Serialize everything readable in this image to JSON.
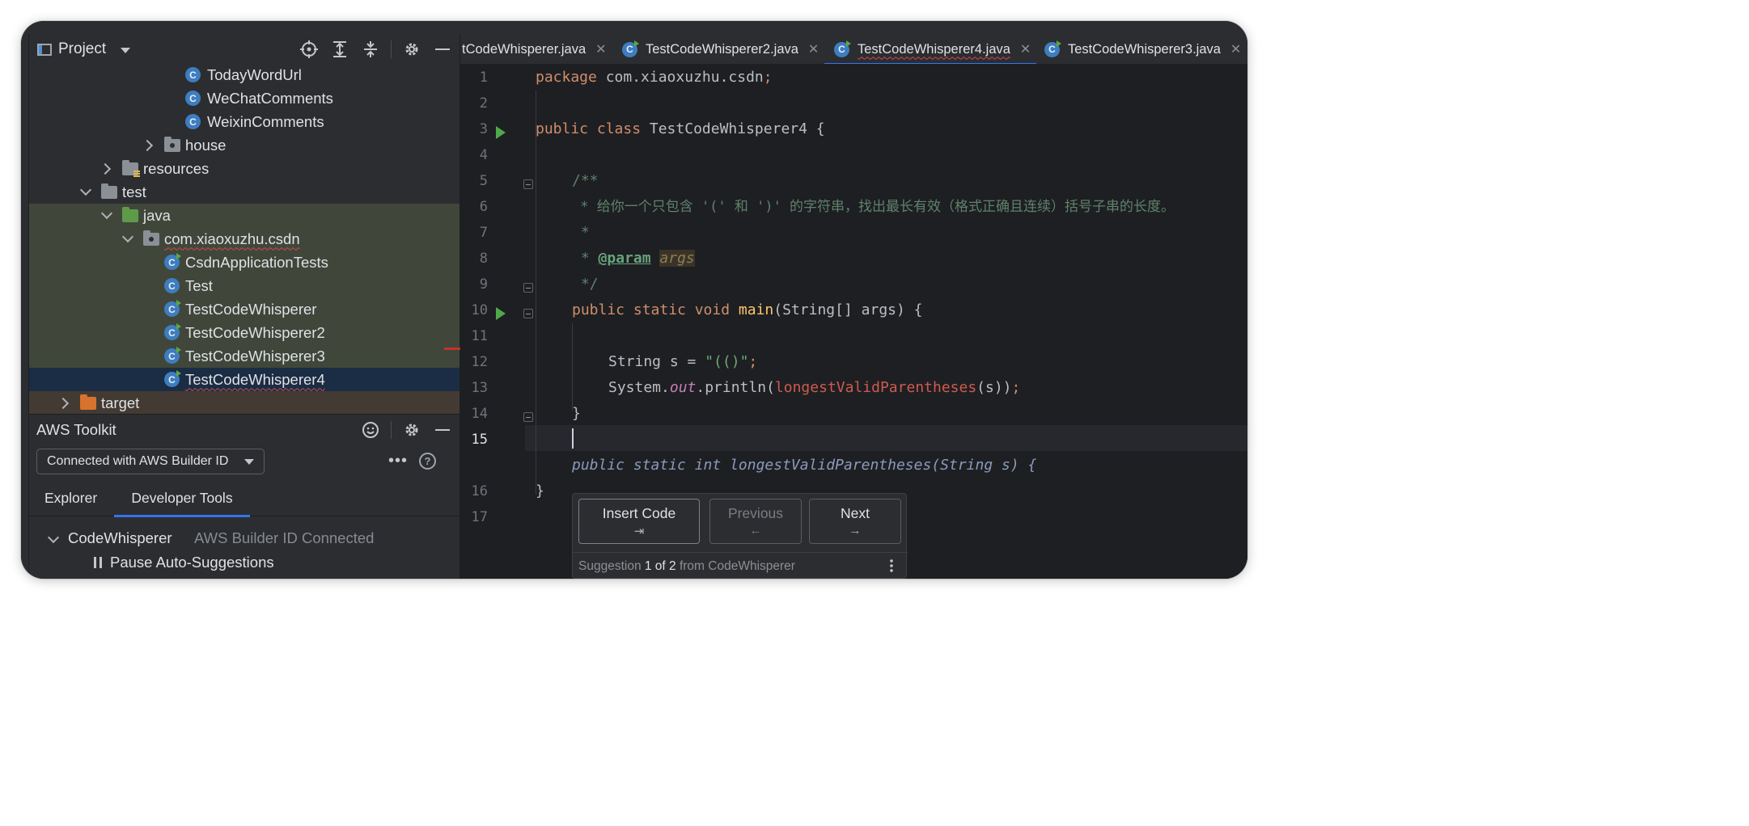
{
  "project_panel": {
    "title": "Project",
    "tree": [
      {
        "label": "TodayWordUrl",
        "kind": "class"
      },
      {
        "label": "WeChatComments",
        "kind": "class"
      },
      {
        "label": "WeixinComments",
        "kind": "class"
      },
      {
        "label": "house",
        "kind": "package-folder",
        "expanded": false
      },
      {
        "label": "resources",
        "kind": "resources-folder",
        "expanded": false
      },
      {
        "label": "test",
        "kind": "folder",
        "expanded": true
      },
      {
        "label": "java",
        "kind": "test-source-folder",
        "expanded": true
      },
      {
        "label": "com.xiaoxuzhu.csdn",
        "kind": "package",
        "expanded": true
      },
      {
        "label": "CsdnApplicationTests",
        "kind": "class"
      },
      {
        "label": "Test",
        "kind": "class"
      },
      {
        "label": "TestCodeWhisperer",
        "kind": "class"
      },
      {
        "label": "TestCodeWhisperer2",
        "kind": "class"
      },
      {
        "label": "TestCodeWhisperer3",
        "kind": "class"
      },
      {
        "label": "TestCodeWhisperer4",
        "kind": "class",
        "selected": true
      },
      {
        "label": "target",
        "kind": "excluded-folder",
        "expanded": false
      }
    ]
  },
  "aws_toolkit": {
    "title": "AWS Toolkit",
    "connection": "Connected with AWS Builder ID",
    "tabs": [
      "Explorer",
      "Developer Tools"
    ],
    "active_tab": "Developer Tools",
    "codewhisperer": {
      "label": "CodeWhisperer",
      "status": "AWS Builder ID Connected"
    },
    "pause_label": "Pause Auto-Suggestions"
  },
  "editor": {
    "tabs": [
      {
        "label": "tCodeWhisperer.java"
      },
      {
        "label": "TestCodeWhisperer2.java"
      },
      {
        "label": "TestCodeWhisperer4.java",
        "active": true
      },
      {
        "label": "TestCodeWhisperer3.java"
      }
    ],
    "line_numbers": [
      "1",
      "2",
      "3",
      "4",
      "5",
      "6",
      "7",
      "8",
      "9",
      "10",
      "11",
      "12",
      "13",
      "14",
      "15",
      "16",
      "17"
    ],
    "current_line": "15",
    "code": {
      "l1_kw": "package",
      "l1_rest": " com.xiaoxuzhu.csdn",
      "l1_semi": ";",
      "l3_kw": "public class",
      "l3_rest": " TestCodeWhisperer4 {",
      "l5": "/**",
      "l6": " * 给你一个只包含 '(' 和 ')' 的字符串，找出最长有效（格式正确且连续）括号子串的长度。",
      "l7": " *",
      "l8_star": " * ",
      "l8_tag": "@param",
      "l8_arg": "args",
      "l9": " */",
      "l10_kw": "public static void",
      "l10_fn": "main",
      "l10_rest": "(String[] args) {",
      "l12_pre": "String s = ",
      "l12_str": "\"(()\"",
      "l12_semi": ";",
      "l13_pre": "System.",
      "l13_fld": "out",
      "l13_mid": ".println(",
      "l13_err": "longestValidParentheses",
      "l13_post": "(s))",
      "l13_semi": ";",
      "l14": "}",
      "ghost": "public static int longestValidParentheses(String s) {",
      "l16": "}"
    }
  },
  "suggestion_popup": {
    "insert_label": "Insert Code",
    "insert_shortcut": "⇥",
    "previous_label": "Previous",
    "previous_shortcut": "←",
    "next_label": "Next",
    "next_shortcut": "→",
    "status_prefix": "Suggestion ",
    "status_count": "1 of 2",
    "status_suffix": " from CodeWhisperer"
  },
  "colors": {
    "accent": "#3574f0",
    "keyword": "#cf8e6d",
    "string": "#6aab73",
    "comment": "#5f826b",
    "error": "#cd5b4f"
  }
}
